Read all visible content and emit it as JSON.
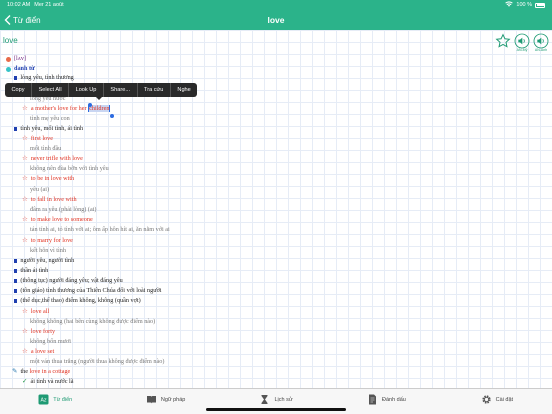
{
  "status": {
    "time": "10:02 AM",
    "date": "Mer 21 août",
    "battery": "100 %"
  },
  "nav": {
    "back_label": "Từ điển",
    "title": "love"
  },
  "headword": "love",
  "icons": {
    "us_label": "AN-Mỹ",
    "uk_label": "AN-Anh"
  },
  "context_menu": [
    "Copy",
    "Select All",
    "Look Up",
    "Share...",
    "Tra cứu",
    "Nghe"
  ],
  "entry": {
    "pronunciation": "[lʌv]",
    "pos1": "danh từ",
    "s1": "lòng yêu, tình thương",
    "s1_ex1_vi": "lòng yêu nước",
    "s1_ex2_en_pre": "a mother's love for her ",
    "s1_ex2_en_sel": "children",
    "s1_ex2_vi": "tình mẹ yêu con",
    "s2": "tình yêu, mối tình, ái tình",
    "ex_first_en": "first love",
    "ex_first_vi": "mối tình đầu",
    "ex_trifle_en": "never trifle with love",
    "ex_trifle_vi": "không nên đùa bỡn với tình yêu",
    "ex_be_en": "to be in love with",
    "ex_be_vi": "yêu (ai)",
    "ex_fall_en": "to fall in love with",
    "ex_fall_vi": "đâm ra yêu (phải lòng) (ai)",
    "ex_make_en": "to make love to someone",
    "ex_make_vi": "tán tỉnh ai, tỏ tình với ai; ôm ấp hôn hít ai, ăn nằm với ai",
    "ex_marry_en": "to marry for love",
    "ex_marry_vi": "kết hôn vì tình",
    "s3": "người yêu, người tình",
    "s4": "thần ái tình",
    "s5": "(thông tục) người đáng yêu; vật đáng yêu",
    "s6": "(tôn giáo) tình thương của Thiên Chúa đối với loài người",
    "s7": "(thể dục,thể thao) điểm không, không (quần vợt)",
    "ex_all_en": "love all",
    "ex_all_vi": "không không (hai bên cùng không được điểm nào)",
    "ex_forty_en": "love forty",
    "ex_forty_vi": "không bốn mươi",
    "ex_set_en": "a love set",
    "ex_set_vi": "một ván thua trắng (người thua không được điểm nào)",
    "idiom_pre": "the ",
    "idiom": "love in a cottage",
    "idiom_vi": "ái tình và nước lã"
  },
  "tabs": [
    "Từ điển",
    "Ngữ pháp",
    "Lịch sử",
    "Đánh dấu",
    "Cài đặt"
  ],
  "colors": {
    "accent": "#2bb38a",
    "example_red": "#e03020",
    "bullet_blue": "#1f3fb0"
  }
}
